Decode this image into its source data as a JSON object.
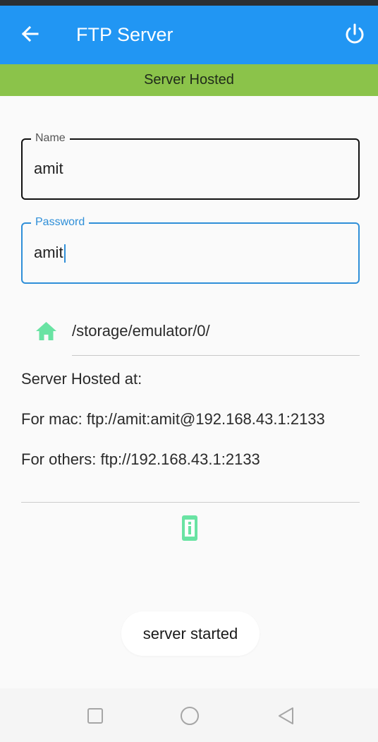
{
  "app_bar": {
    "title": "FTP Server",
    "back_icon": "arrow-back-icon",
    "power_icon": "power-icon",
    "color": "#2196f3"
  },
  "banner": {
    "text": "Server Hosted",
    "color": "#8bc34a"
  },
  "form": {
    "name": {
      "label": "Name",
      "value": "amit"
    },
    "password": {
      "label": "Password",
      "value": "amit"
    }
  },
  "path": {
    "icon": "home-icon",
    "value": "/storage/emulator/0/"
  },
  "server_info": {
    "heading": "Server Hosted at:",
    "mac": "For mac: ftp://amit:amit@192.168.43.1:2133",
    "others": "For others: ftp://192.168.43.1:2133"
  },
  "info_icon": "info-icon",
  "toast": {
    "text": "server started"
  },
  "navigation": {
    "recents_icon": "recents-square-icon",
    "home_icon": "home-circle-icon",
    "back_icon": "back-triangle-icon"
  },
  "colors": {
    "accent": "#2f8fd8",
    "icon_green": "#69e3a3"
  }
}
